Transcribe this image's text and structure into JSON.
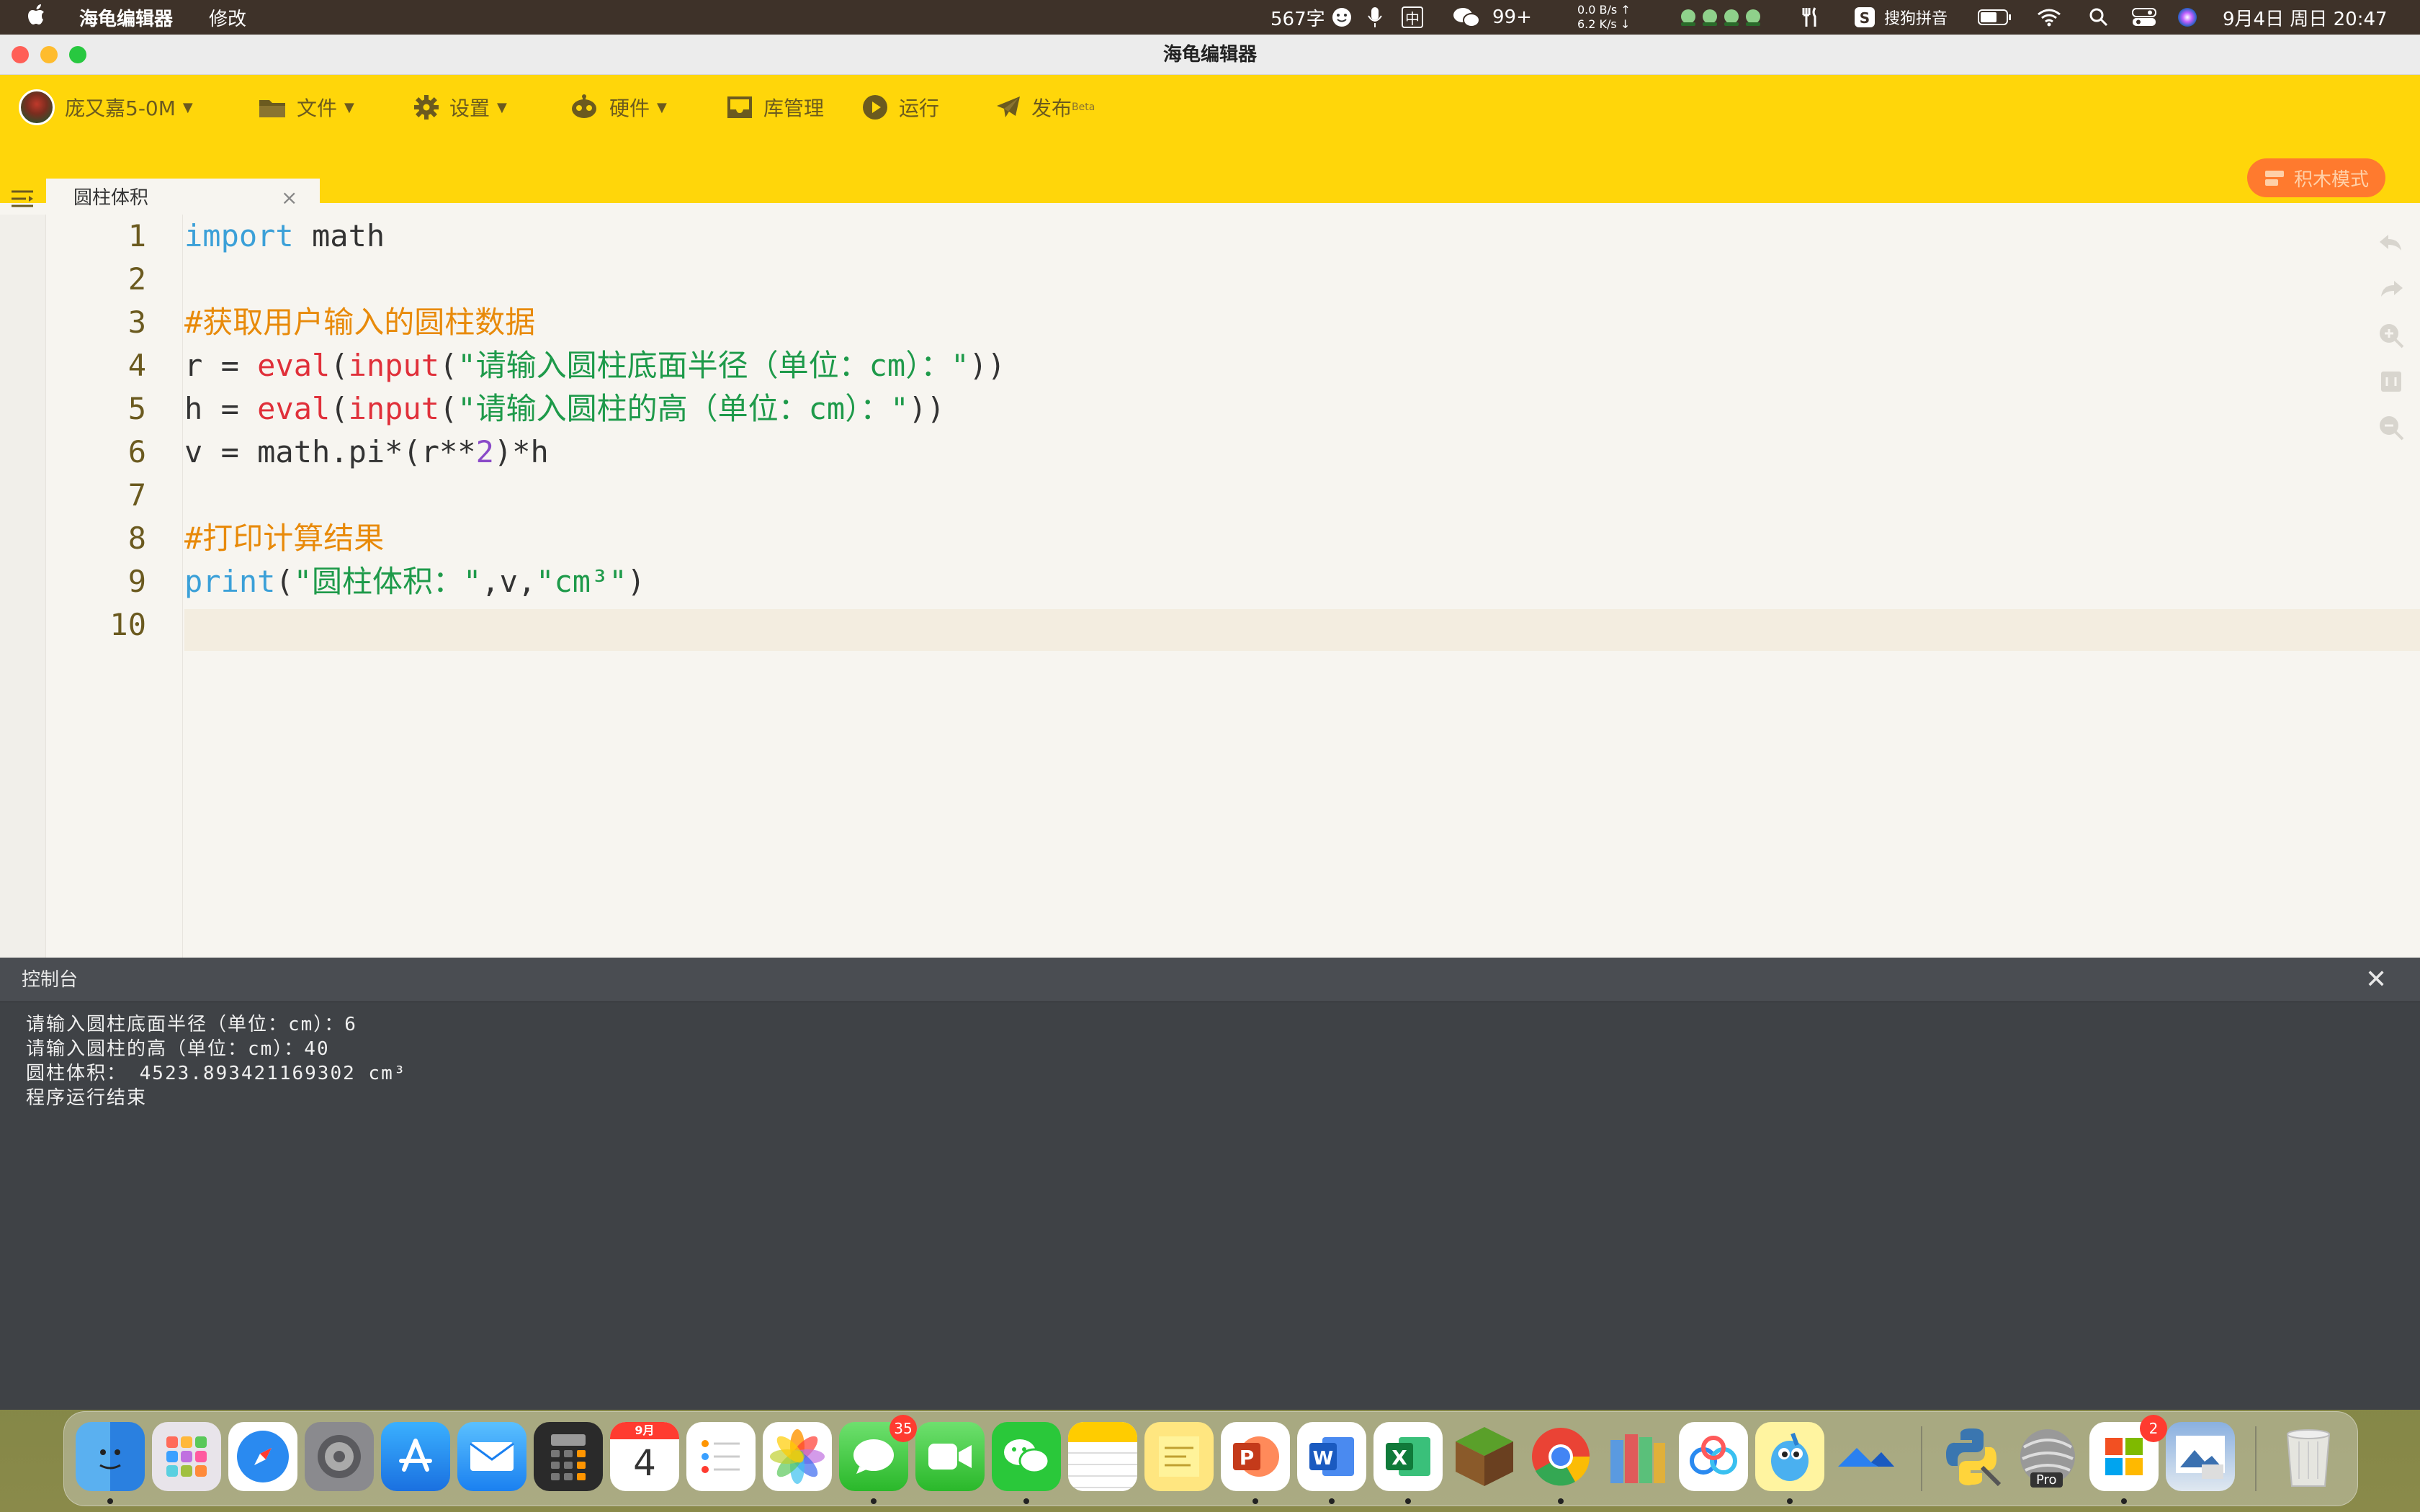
{
  "menubar": {
    "app_name": "海龟编辑器",
    "menu_edit": "修改",
    "word_count": "567字",
    "input_method_cn": "中",
    "wechat_count": "99+",
    "net_up": "0.0 B/s ↑",
    "net_down": "6.2 K/s ↓",
    "sogou": "搜狗拼音",
    "datetime": "9月4日 周日 20:47"
  },
  "window": {
    "title": "海龟编辑器",
    "traffic_colors": [
      "#ff5f57",
      "#febc2e",
      "#28c840"
    ]
  },
  "toolbar": {
    "user": "庞又嘉5-0M",
    "file": "文件",
    "settings": "设置",
    "hardware": "硬件",
    "library": "库管理",
    "run": "运行",
    "publish": "发布",
    "publish_badge": "Beta",
    "block_mode": "积木模式"
  },
  "tab": {
    "name": "圆柱体积",
    "close": "×"
  },
  "editor": {
    "line_numbers": [
      "1",
      "2",
      "3",
      "4",
      "5",
      "6",
      "7",
      "8",
      "9",
      "10"
    ],
    "lines": {
      "l1": {
        "kw": "import",
        "rest": " math"
      },
      "l3": {
        "comment": "#获取用户输入的圆柱数据"
      },
      "l4": {
        "a": "r = ",
        "fn": "eval",
        "b": "(",
        "fn2": "input",
        "c": "(",
        "str": "\"请输入圆柱底面半径（单位：cm）：\"",
        "d": "))"
      },
      "l5": {
        "a": "h = ",
        "fn": "eval",
        "b": "(",
        "fn2": "input",
        "c": "(",
        "str": "\"请输入圆柱的高（单位：cm）：\"",
        "d": "))"
      },
      "l6": {
        "a": "v = math.pi*(r**",
        "num": "2",
        "b": ")*h"
      },
      "l8": {
        "comment": "#打印计算结果"
      },
      "l9": {
        "kw": "print",
        "a": "(",
        "str": "\"圆柱体积：\"",
        "b": ",v,",
        "str2": "\"cm³\"",
        "c": ")"
      }
    },
    "run_button": "运行"
  },
  "console": {
    "title": "控制台",
    "close": "✕",
    "output": [
      "请输入圆柱底面半径（单位：cm）：6",
      "请输入圆柱的高（单位：cm）：40",
      "圆柱体积： 4523.893421169302 cm³",
      "程序运行结束"
    ]
  },
  "dock": {
    "calendar_month": "9月",
    "calendar_day": "4",
    "messages_badge": "35",
    "office_badge": "2",
    "pro_label": "Pro"
  },
  "colors": {
    "toolbar_yellow": "#ffd60a",
    "block_mode_orange": "#ff7a2e",
    "keyword_blue": "#3ba0d8",
    "function_red": "#e0303a",
    "string_green": "#1e9a4a",
    "comment_orange": "#e88a0a",
    "console_bg": "#3f4246"
  }
}
